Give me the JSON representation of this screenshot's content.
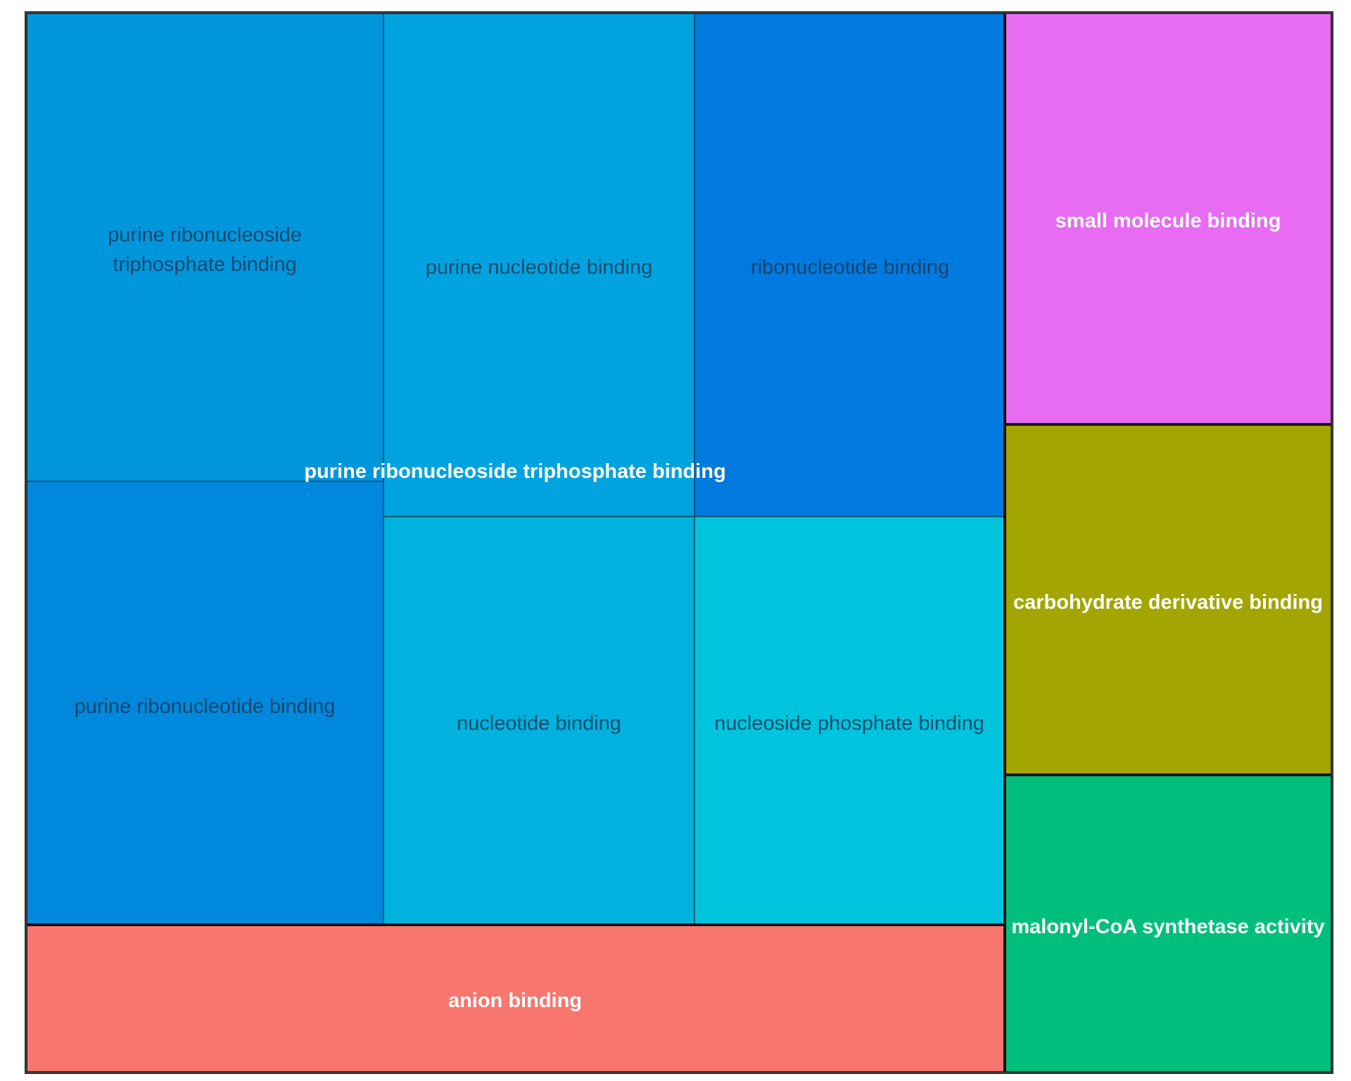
{
  "chart_data": {
    "type": "treemap",
    "groups": [
      {
        "name": "purine ribonucleoside triphosphate binding",
        "color": "#00A5FF",
        "children": [
          {
            "name": "purine ribonucleoside triphosphate binding",
            "label_lines": [
              "purine ribonucleoside",
              "triphosphate binding"
            ],
            "color": "#0096DB"
          },
          {
            "name": "purine ribonucleotide binding",
            "label_lines": [
              "purine ribonucleotide binding"
            ],
            "color": "#0088DC"
          },
          {
            "name": "purine nucleotide binding",
            "label_lines": [
              "purine nucleotide binding"
            ],
            "color": "#00A3DF"
          },
          {
            "name": "nucleotide binding",
            "label_lines": [
              "nucleotide binding"
            ],
            "color": "#00B2DD"
          },
          {
            "name": "ribonucleotide binding",
            "label_lines": [
              "ribonucleotide binding"
            ],
            "color": "#007ADE"
          },
          {
            "name": "nucleoside phosphate binding",
            "label_lines": [
              "nucleoside phosphate binding"
            ],
            "color": "#00C4DE"
          }
        ]
      },
      {
        "name": "anion binding",
        "color": "#F8766D",
        "children": []
      },
      {
        "name": "small molecule binding",
        "color": "#E76BF3",
        "children": []
      },
      {
        "name": "carbohydrate derivative binding",
        "color": "#A3A500",
        "children": []
      },
      {
        "name": "malonyl-CoA synthetase activity",
        "color": "#00BF7D",
        "children": []
      }
    ]
  }
}
